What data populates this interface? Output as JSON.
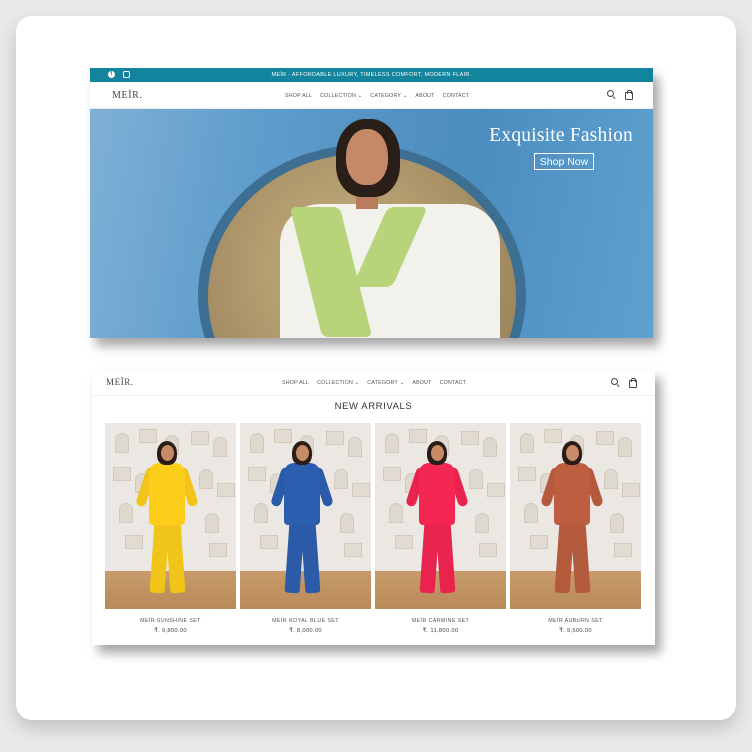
{
  "announcement": {
    "text": "MEÏR - AFFORDABLE LUXURY, TIMELESS COMFORT, MODERN FLAIR.",
    "social_icons": [
      "facebook-icon",
      "instagram-icon"
    ]
  },
  "brand": {
    "logo": "MEÏR."
  },
  "nav": {
    "items": [
      "SHOP ALL",
      "COLLECTION ⌄",
      "CATEGORY ⌄",
      "ABOUT",
      "CONTACT"
    ]
  },
  "hero": {
    "title": "Exquisite Fashion",
    "button_label": "Shop Now"
  },
  "new_arrivals": {
    "title": "NEW ARRIVALS",
    "products": [
      {
        "name": "MEÏR SUNSHINE SET",
        "price": "₹. 9,800.00",
        "color": "#f0c419"
      },
      {
        "name": "MEÏR ROYAL BLUE SET",
        "price": "₹. 8,000.00",
        "color": "#2a5aa8"
      },
      {
        "name": "MEÏR CARMINE SET",
        "price": "₹. 11,800.00",
        "color": "#e8244e"
      },
      {
        "name": "MEÏR AUBURN SET",
        "price": "₹. 9,500.00",
        "color": "#b35a3c"
      }
    ]
  },
  "colors": {
    "announcement_bar": "#13849e",
    "hero_background": "#5d9ccb",
    "card_background": "#ffffff",
    "page_background": "#e9e9e9"
  }
}
